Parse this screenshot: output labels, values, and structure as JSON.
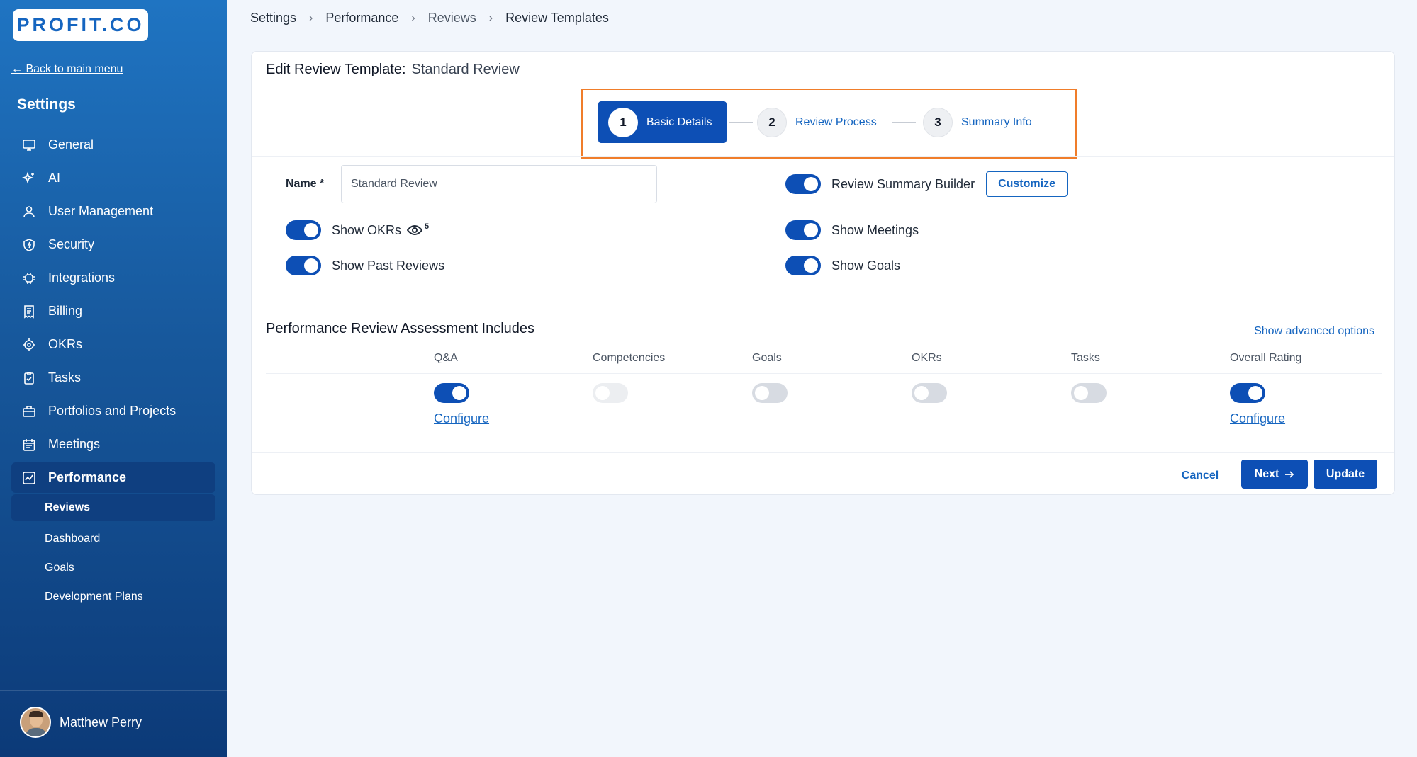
{
  "brand": {
    "logo_text": "PROFIT.CO",
    "accent": "#0d4fb5",
    "highlight": "#f07d2a"
  },
  "sidebar": {
    "back_link": "← Back to main menu",
    "heading": "Settings",
    "items": [
      {
        "label": "General",
        "icon": "monitor-icon"
      },
      {
        "label": "AI",
        "icon": "sparkle-icon"
      },
      {
        "label": "User Management",
        "icon": "user-icon"
      },
      {
        "label": "Security",
        "icon": "shield-icon"
      },
      {
        "label": "Integrations",
        "icon": "chip-icon"
      },
      {
        "label": "Billing",
        "icon": "receipt-icon"
      },
      {
        "label": "OKRs",
        "icon": "target-icon"
      },
      {
        "label": "Tasks",
        "icon": "clipboard-icon"
      },
      {
        "label": "Portfolios and Projects",
        "icon": "briefcase-icon"
      },
      {
        "label": "Meetings",
        "icon": "calendar-icon"
      },
      {
        "label": "Performance",
        "icon": "chart-icon"
      }
    ],
    "sub_items": [
      "Reviews",
      "Dashboard",
      "Goals",
      "Development Plans"
    ],
    "user_name": "Matthew Perry"
  },
  "breadcrumb": [
    "Settings",
    "Performance",
    "Reviews",
    "Review Templates"
  ],
  "card": {
    "title_label": "Edit Review Template:",
    "title_value": "Standard Review",
    "steps": [
      {
        "num": "1",
        "label": "Basic Details",
        "active": true
      },
      {
        "num": "2",
        "label": "Review Process",
        "active": false
      },
      {
        "num": "3",
        "label": "Summary Info",
        "active": false
      }
    ],
    "name_label": "Name *",
    "name_value": "Standard Review",
    "left_toggles": [
      {
        "label": "Show OKRs",
        "on": true,
        "badge": "5"
      },
      {
        "label": "Show Past Reviews",
        "on": true
      }
    ],
    "right_toggles": [
      {
        "label": "Review Summary Builder",
        "on": true
      },
      {
        "label": "Show Meetings",
        "on": true
      },
      {
        "label": "Show Goals",
        "on": true
      }
    ],
    "customize_label": "Customize",
    "assessment_title": "Performance Review Assessment Includes",
    "advanced_link": "Show advanced options",
    "assessment_columns": [
      {
        "label": "Q&A",
        "state": "on",
        "configure": "Configure"
      },
      {
        "label": "Competencies",
        "state": "disabled"
      },
      {
        "label": "Goals",
        "state": "off"
      },
      {
        "label": "OKRs",
        "state": "off"
      },
      {
        "label": "Tasks",
        "state": "off"
      },
      {
        "label": "Overall Rating",
        "state": "on",
        "configure": "Configure"
      }
    ],
    "buttons": {
      "cancel": "Cancel",
      "next": "Next",
      "update": "Update"
    }
  }
}
